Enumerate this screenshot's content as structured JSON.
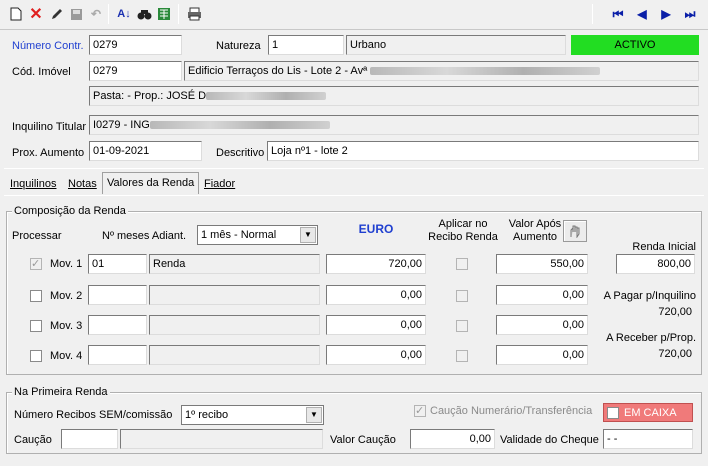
{
  "toolbar": {
    "icons": [
      "new-doc-icon",
      "delete-icon",
      "edit-icon",
      "save-icon",
      "undo-icon",
      "sort-icon",
      "find-icon",
      "export-icon",
      "print-icon"
    ],
    "nav": [
      "first-icon",
      "prev-icon",
      "next-icon",
      "last-icon"
    ]
  },
  "header": {
    "numero_label": "Número Contr.",
    "numero_value": "0279",
    "natureza_label": "Natureza",
    "natureza_code": "1",
    "natureza_desc": "Urbano",
    "status": "ACTIVO",
    "status_color": "#22dd22",
    "cod_imovel_label": "Cód. Imóvel",
    "cod_imovel_value": "0279",
    "imovel_desc": "Edificio Terraços do Lis  - Lote 2 - Avª",
    "pasta_text": "Pasta:  -  Prop.: JOSÉ D",
    "inquilino_label": "Inquilino Titular",
    "inquilino_value": "I0279 - ING",
    "prox_aumento_label": "Prox. Aumento",
    "prox_aumento_value": "01-09-2021",
    "descritivo_label": "Descritivo",
    "descritivo_value": "Loja nº1 - lote 2"
  },
  "tabs": [
    {
      "label": "Inquilinos"
    },
    {
      "label": "Notas"
    },
    {
      "label": "Valores da Renda"
    },
    {
      "label": "Fiador"
    }
  ],
  "composicao": {
    "title": "Composição da Renda",
    "processar": "Processar",
    "meses_label": "Nº meses Adiant.",
    "meses_value": "1 mês - Normal",
    "currency": "EURO",
    "aplicar_label": "Aplicar no Recibo Renda",
    "valor_apos_label": "Valor Após Aumento",
    "renda_inicial_label": "Renda Inicial",
    "renda_inicial_value": "800,00",
    "a_pagar_label": "A Pagar p/Inquilino",
    "a_pagar_value": "720,00",
    "a_receber_label": "A Receber p/Prop.",
    "a_receber_value": "720,00",
    "rows": [
      {
        "mov": "Mov. 1",
        "code": "01",
        "desc": "Renda",
        "value": "720,00",
        "after": "550,00"
      },
      {
        "mov": "Mov. 2",
        "code": "",
        "desc": "",
        "value": "0,00",
        "after": "0,00"
      },
      {
        "mov": "Mov. 3",
        "code": "",
        "desc": "",
        "value": "0,00",
        "after": "0,00"
      },
      {
        "mov": "Mov. 4",
        "code": "",
        "desc": "",
        "value": "0,00",
        "after": "0,00"
      }
    ]
  },
  "primeira": {
    "title": "Na Primeira Renda",
    "recibos_label": "Número Recibos SEM/comissão",
    "recibos_value": "1º recibo",
    "caucao_check_label": "Caução Numerário/Transferência",
    "em_caixa_label": "EM CAIXA",
    "em_caixa_color": "#f07a7a",
    "caucao_label": "Caução",
    "valor_caucao_label": "Valor Caução",
    "valor_caucao_value": "0,00",
    "validade_label": "Validade do Cheque",
    "validade_value": " - -"
  }
}
